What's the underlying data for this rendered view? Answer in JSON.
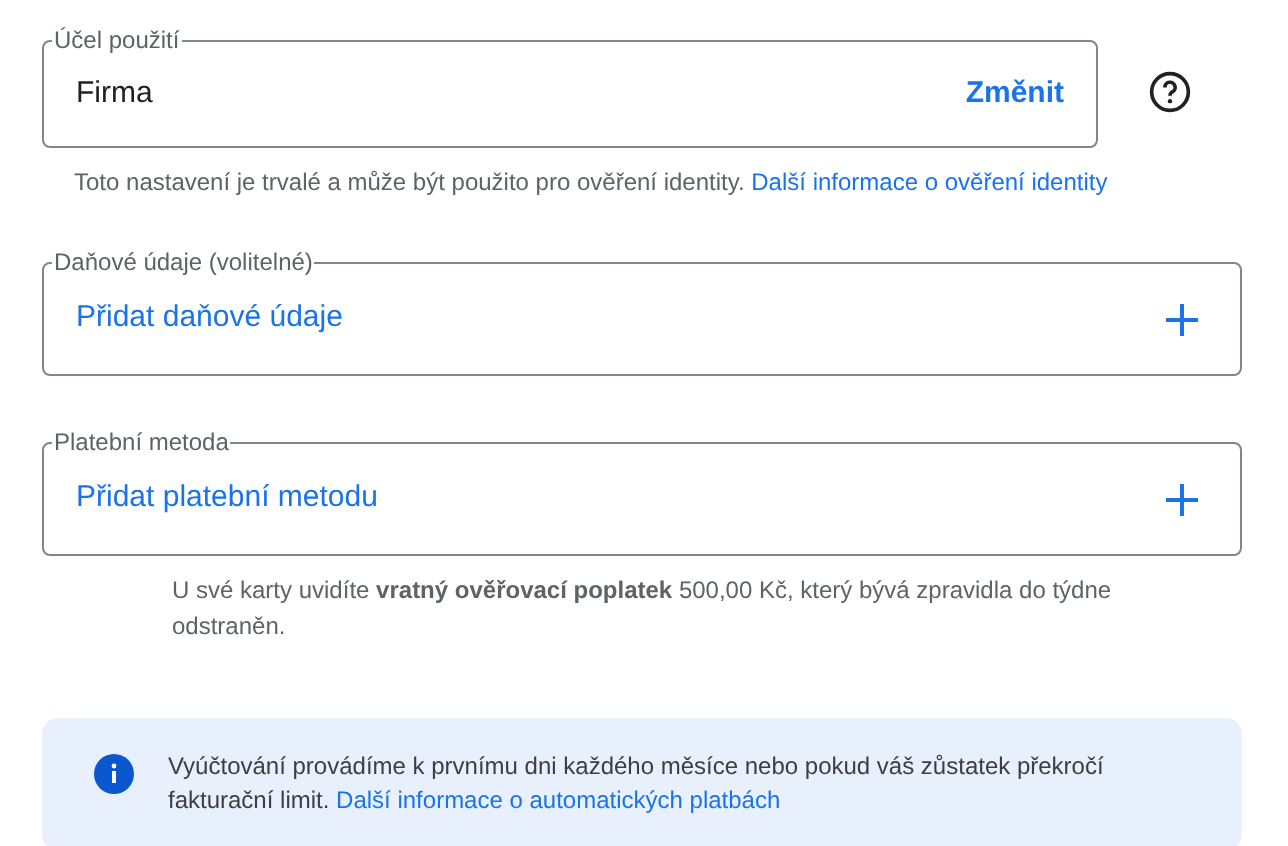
{
  "usage": {
    "label": "Účel použití",
    "value": "Firma",
    "action": "Změnit",
    "hint": "Toto nastavení je trvalé a může být použito pro ověření identity.",
    "hint_link": "Další informace o ověření identity"
  },
  "sections": [
    {
      "label": "Daňové údaje (volitelné)",
      "action": "Přidat daňové údaje"
    },
    {
      "label": "Platební metoda",
      "action": "Přidat platební metodu"
    }
  ],
  "card_note": "U své karty uvidíte **vratný ověřovací poplatek** 500,00 Kč, který bývá zpravidla do týdne odstraněn.",
  "info": {
    "text": "Vyúčtování provádíme k prvnímu dni každého měsíce nebo pokud váš zůstatek překročí fakturační limit.",
    "link": "Další informace o automatických platbách"
  }
}
